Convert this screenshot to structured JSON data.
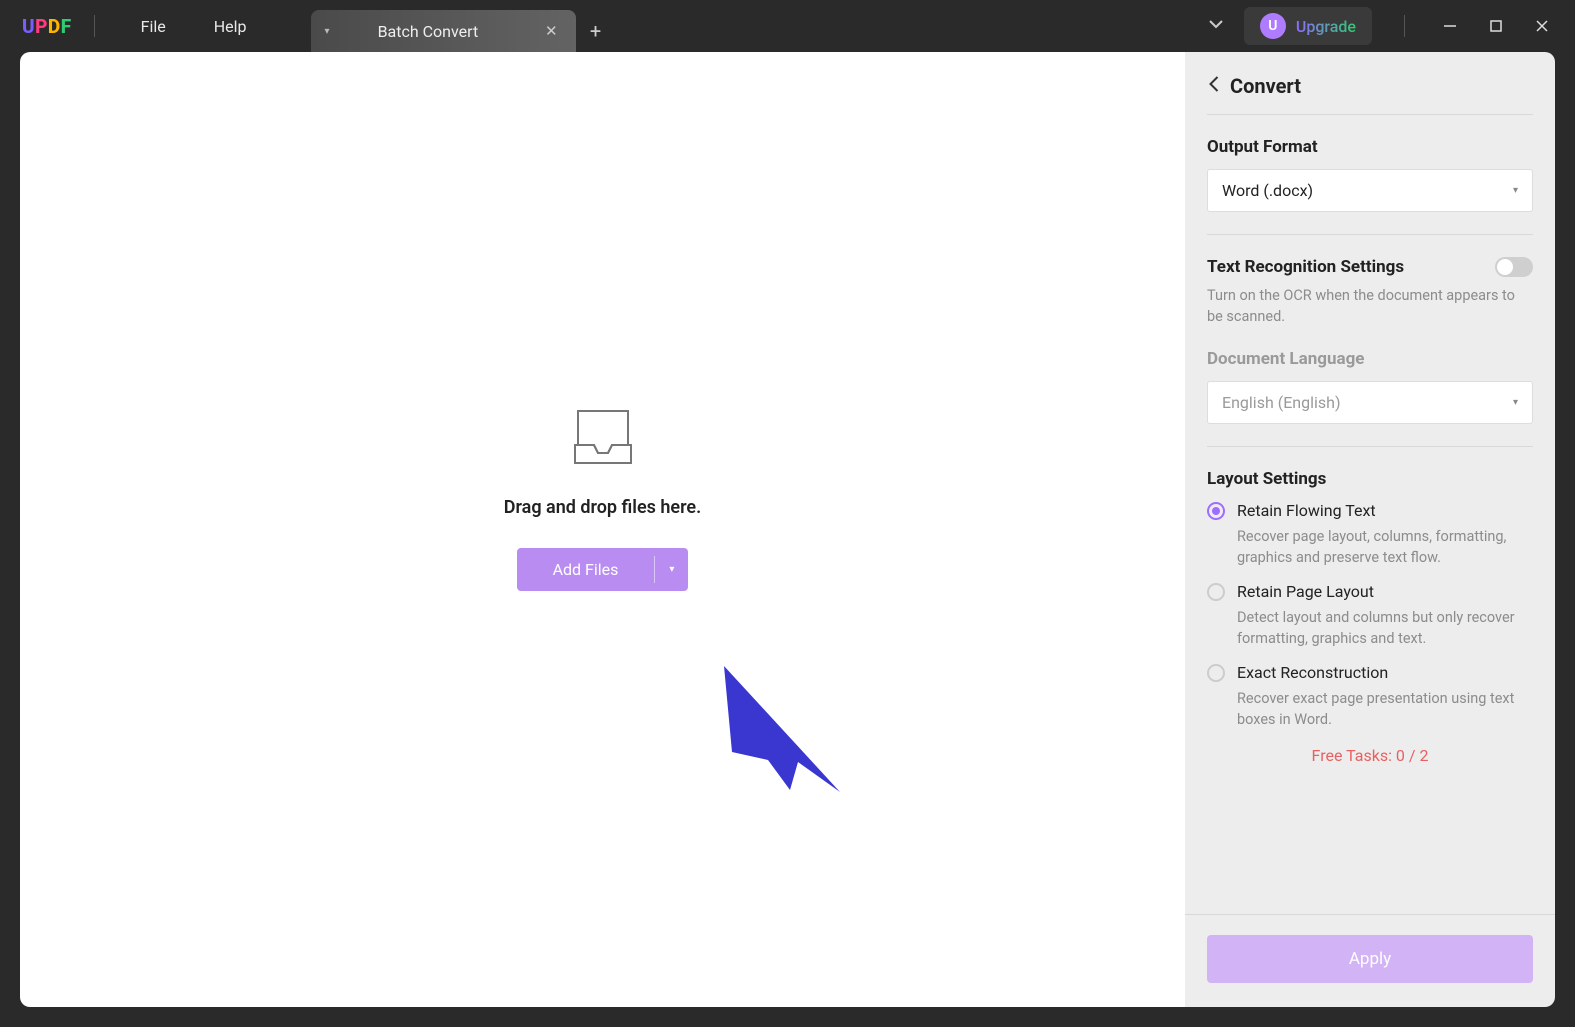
{
  "titlebar": {
    "logo": {
      "u": "U",
      "p": "P",
      "d": "D",
      "f": "F"
    },
    "menu": {
      "file": "File",
      "help": "Help"
    },
    "tab": {
      "label": "Batch Convert"
    },
    "upgrade": {
      "badge": "U",
      "label": "Upgrade"
    }
  },
  "main": {
    "drop_text": "Drag and drop files here.",
    "add_files": "Add Files"
  },
  "sidebar": {
    "title": "Convert",
    "output_format": {
      "label": "Output Format",
      "value": "Word (.docx)"
    },
    "ocr": {
      "label": "Text Recognition Settings",
      "desc": "Turn on the OCR when the document appears to be scanned."
    },
    "language": {
      "label": "Document Language",
      "value": "English (English)"
    },
    "layout": {
      "label": "Layout Settings",
      "options": [
        {
          "label": "Retain Flowing Text",
          "desc": "Recover page layout, columns, formatting, graphics and preserve text flow.",
          "checked": true
        },
        {
          "label": "Retain Page Layout",
          "desc": "Detect layout and columns but only recover formatting, graphics and text.",
          "checked": false
        },
        {
          "label": "Exact Reconstruction",
          "desc": "Recover exact page presentation using text boxes in Word.",
          "checked": false
        }
      ]
    },
    "free_tasks": "Free Tasks: 0 / 2",
    "apply": "Apply"
  }
}
